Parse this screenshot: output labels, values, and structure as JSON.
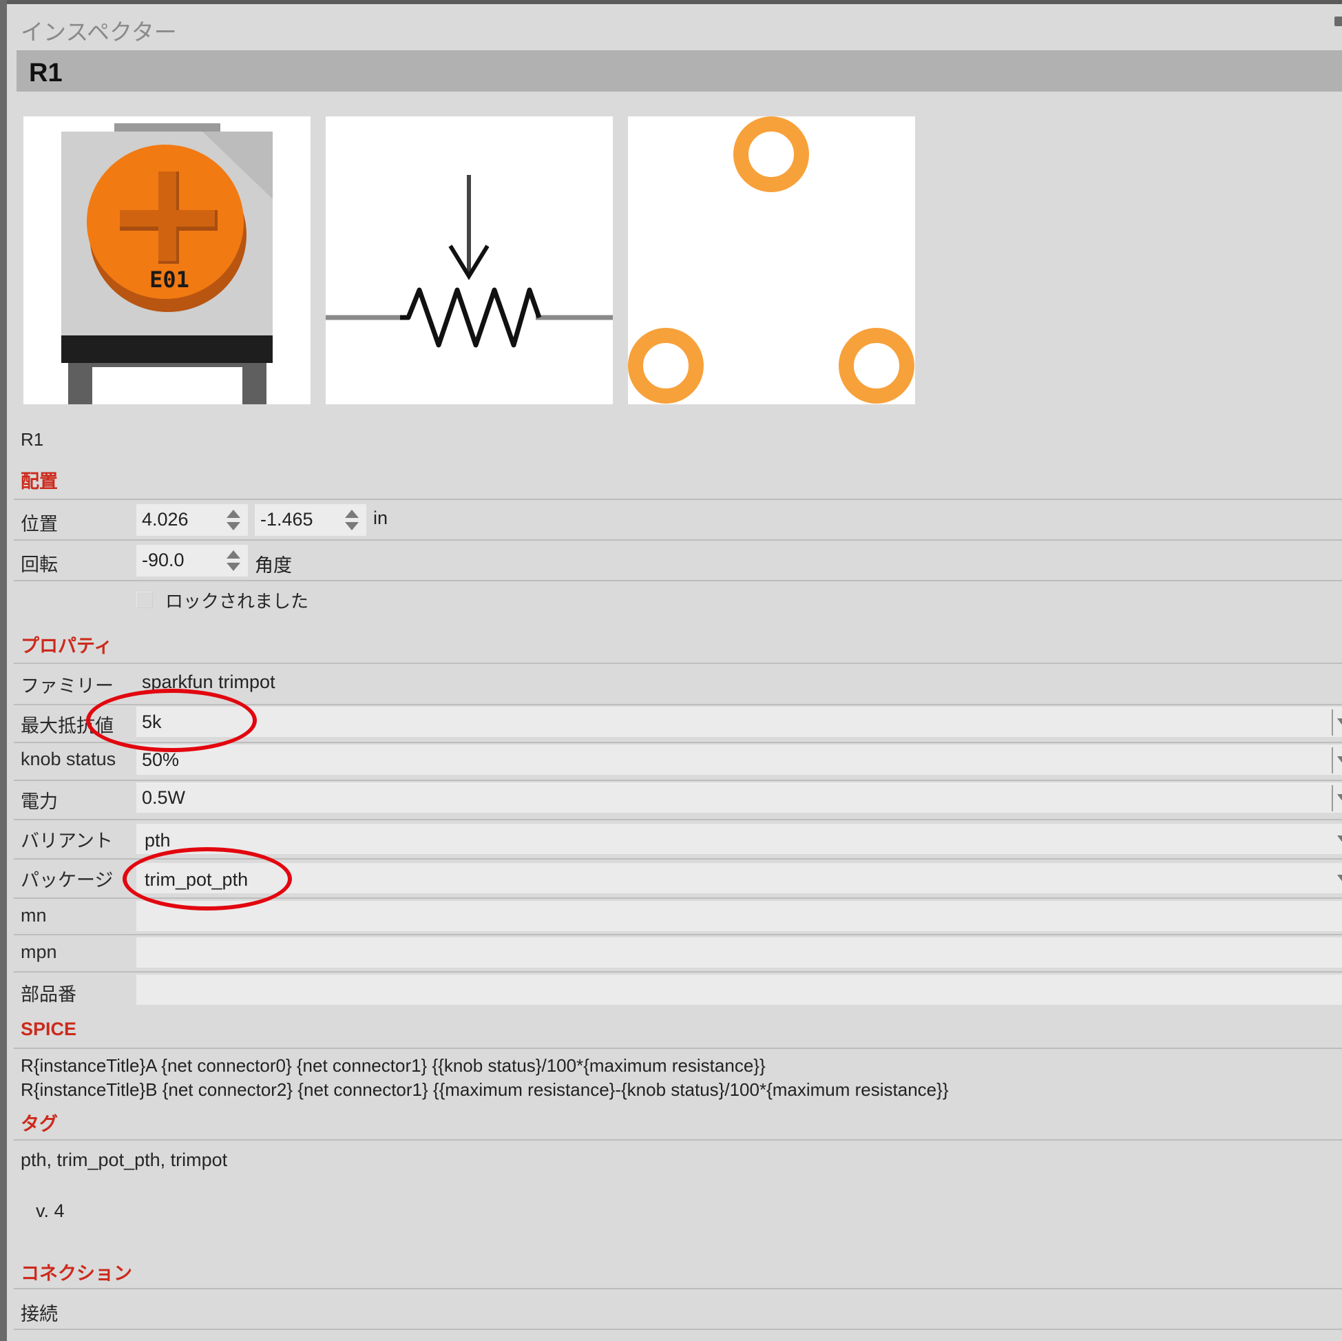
{
  "panel": {
    "title": "インスペクター"
  },
  "header": {
    "title": "R1"
  },
  "part": {
    "name": "R1"
  },
  "placement": {
    "section_title": "配置",
    "position_label": "位置",
    "position_x": "4.026",
    "position_y": "-1.465",
    "position_unit": "in",
    "rotation_label": "回転",
    "rotation_value": "-90.0",
    "rotation_unit": "角度",
    "lock_label": "ロックされました",
    "locked": false
  },
  "properties": {
    "section_title": "プロパティ",
    "family_label": "ファミリー",
    "family_value": "sparkfun trimpot",
    "rows": [
      {
        "label": "最大抵抗値",
        "value": "5k"
      },
      {
        "label": "knob status",
        "value": "50%"
      },
      {
        "label": "電力",
        "value": "0.5W"
      },
      {
        "label": "バリアント",
        "value": "pth"
      },
      {
        "label": "パッケージ",
        "value": "trim_pot_pth"
      },
      {
        "label": "mn",
        "value": ""
      },
      {
        "label": "mpn",
        "value": ""
      },
      {
        "label": "部品番",
        "value": ""
      }
    ]
  },
  "spice": {
    "section_title": "SPICE",
    "lines": [
      "R{instanceTitle}A {net connector0} {net connector1} {{knob status}/100*{maximum resistance}}",
      "R{instanceTitle}B {net connector2} {net connector1} {{maximum resistance}-{knob status}/100*{maximum resistance}}"
    ]
  },
  "tags": {
    "section_title": "タグ",
    "value": "pth, trim_pot_pth, trimpot"
  },
  "version": "v. 4",
  "connections": {
    "section_title": "コネクション",
    "connected_label": "接続"
  },
  "images": [
    {
      "name": "breadboard-view-icon",
      "text": "E01"
    },
    {
      "name": "schematic-view-icon"
    },
    {
      "name": "pcb-view-icon"
    }
  ],
  "colors": {
    "accent_header": "#cc2a1c",
    "annotation": "#e2070f",
    "knob": "#f27a12",
    "pad": "#f7a13b"
  }
}
